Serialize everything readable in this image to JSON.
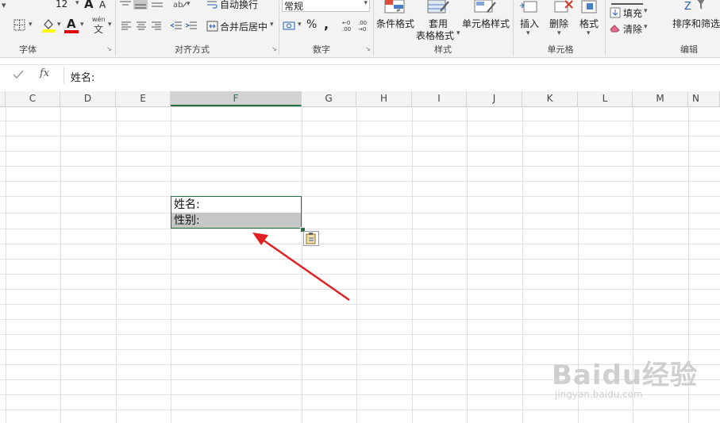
{
  "ribbon": {
    "font_size_value": "12",
    "groups": {
      "font": "字体",
      "alignment": "对齐方式",
      "number": "数字",
      "styles": "样式",
      "cells": "单元格",
      "editing": "编辑"
    },
    "wrap_text": "自动换行",
    "merge_center": "合并后居中",
    "number_format": "常规",
    "percent": "%",
    "comma": ",",
    "conditional_format": "条件格式",
    "table_format_line1": "套用",
    "table_format_line2": "表格格式",
    "cell_styles": "单元格样式",
    "insert": "插入",
    "delete": "删除",
    "format": "格式",
    "fill": "填充",
    "clear": "清除",
    "sort_filter": "排序和筛选",
    "wen_top": "wén",
    "wen_bottom": "文",
    "font_grow": "A",
    "font_shrink": "A",
    "font_color": "A"
  },
  "formula_bar": {
    "fx": "fx",
    "content": "姓名:"
  },
  "columns": [
    "C",
    "D",
    "E",
    "F",
    "G",
    "H",
    "I",
    "J",
    "K",
    "L",
    "M",
    "N"
  ],
  "cells": {
    "f1": "姓名:",
    "f2": "性别:"
  },
  "watermark": {
    "brand": "Baidu经验",
    "url": "jingyan.baidu.com"
  },
  "colors": {
    "accent_green": "#217346",
    "arrow_red": "#e02020",
    "selected_fill": "#c6c6c6"
  }
}
